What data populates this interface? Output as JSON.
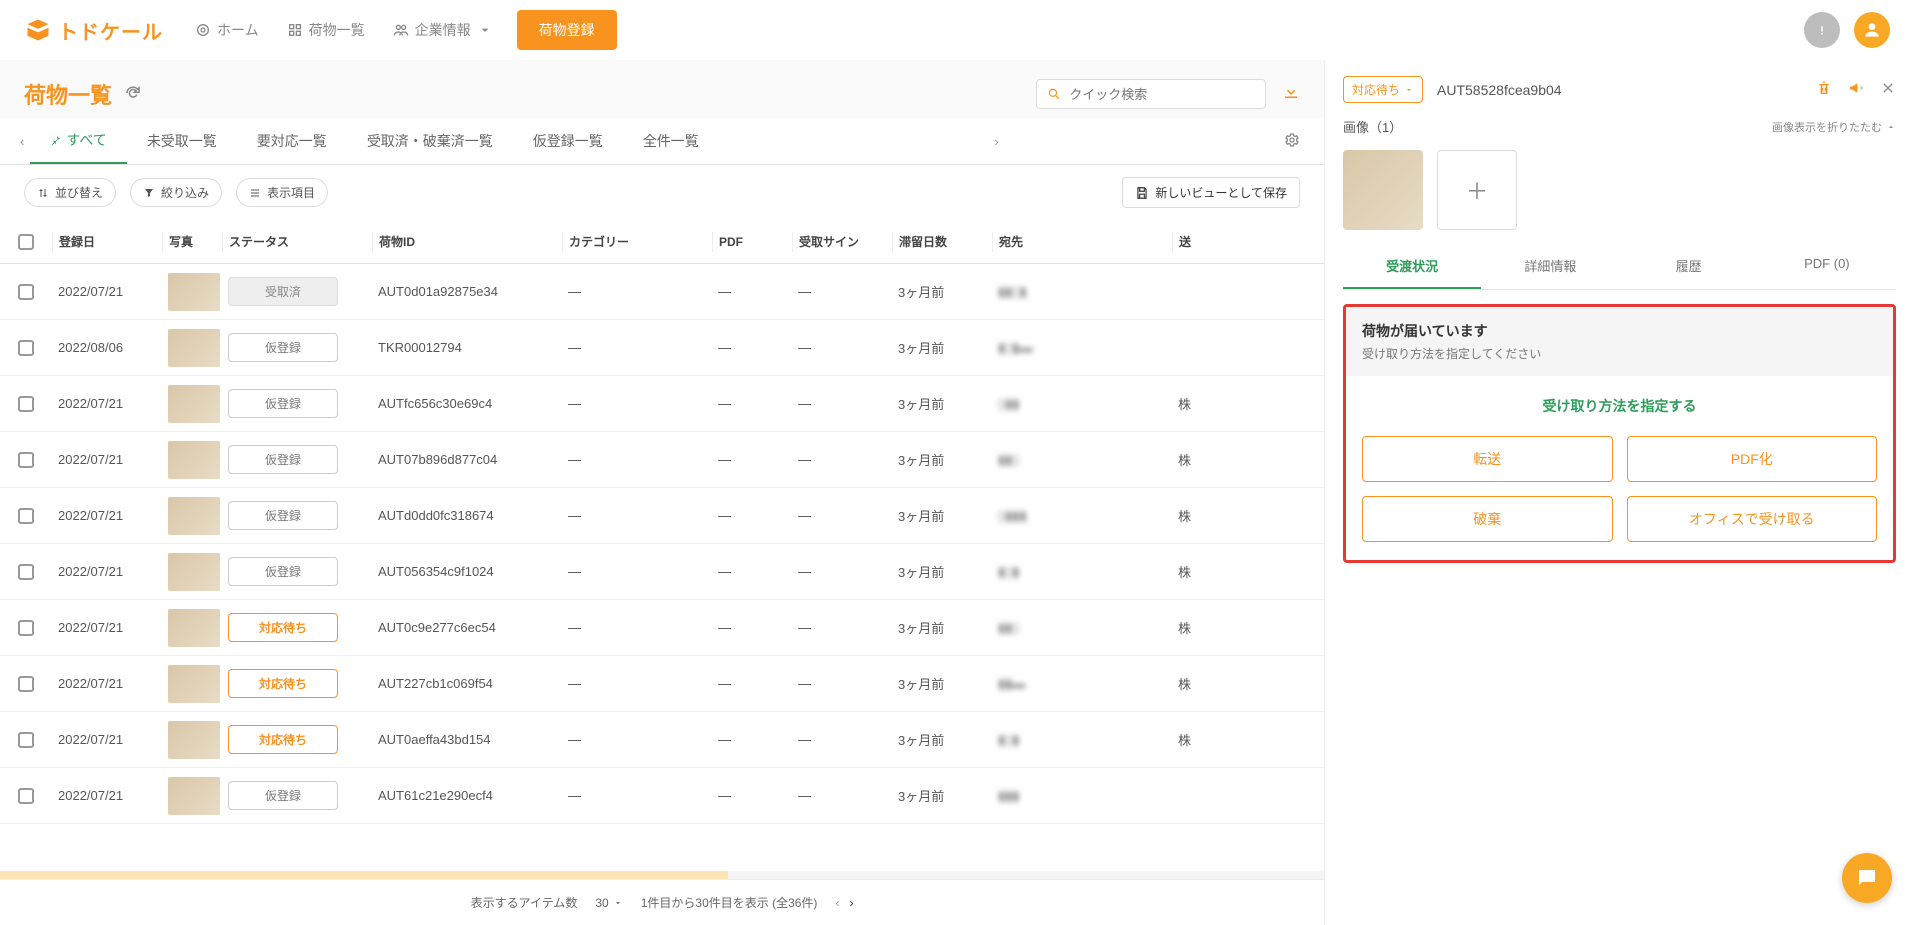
{
  "brand": "トドケール",
  "nav": {
    "home": "ホーム",
    "list": "荷物一覧",
    "company": "企業情報"
  },
  "primary_btn": "荷物登録",
  "page_title": "荷物一覧",
  "search_placeholder": "クイック検索",
  "tabs": {
    "all": "すべて",
    "unreceived": "未受取一覧",
    "needaction": "要対応一覧",
    "done": "受取済・破棄済一覧",
    "draft": "仮登録一覧",
    "everything": "全件一覧"
  },
  "toolbar": {
    "sort": "並び替え",
    "filter": "絞り込み",
    "columns": "表示項目",
    "save_view": "新しいビューとして保存"
  },
  "columns": {
    "date": "登録日",
    "photo": "写真",
    "status": "ステータス",
    "pkgid": "荷物ID",
    "category": "カテゴリー",
    "pdf": "PDF",
    "sign": "受取サイン",
    "days": "滞留日数",
    "dest": "宛先",
    "sender": "送"
  },
  "status_labels": {
    "received": "受取済",
    "draft": "仮登録",
    "pending": "対応待ち"
  },
  "rows": [
    {
      "date": "2022/07/21",
      "status": "received",
      "id": "AUT0d01a92875e34",
      "days": "3ヶ月前",
      "dest": "▮▮▯▮",
      "sender": ""
    },
    {
      "date": "2022/08/06",
      "status": "draft",
      "id": "TKR00012794",
      "days": "3ヶ月前",
      "dest": "▮▯▮▬",
      "sender": ""
    },
    {
      "date": "2022/07/21",
      "status": "draft",
      "id": "AUTfc656c30e69c4",
      "days": "3ヶ月前",
      "dest": "▯▮▮",
      "sender": "株"
    },
    {
      "date": "2022/07/21",
      "status": "draft",
      "id": "AUT07b896d877c04",
      "days": "3ヶ月前",
      "dest": "▮▮▯",
      "sender": "株"
    },
    {
      "date": "2022/07/21",
      "status": "draft",
      "id": "AUTd0dd0fc318674",
      "days": "3ヶ月前",
      "dest": "▯▮▮▮",
      "sender": "株"
    },
    {
      "date": "2022/07/21",
      "status": "draft",
      "id": "AUT056354c9f1024",
      "days": "3ヶ月前",
      "dest": "▮▯▮",
      "sender": "株"
    },
    {
      "date": "2022/07/21",
      "status": "pending",
      "id": "AUT0c9e277c6ec54",
      "days": "3ヶ月前",
      "dest": "▮▮▯",
      "sender": "株"
    },
    {
      "date": "2022/07/21",
      "status": "pending",
      "id": "AUT227cb1c069f54",
      "days": "3ヶ月前",
      "dest": "▮▮▬",
      "sender": "株"
    },
    {
      "date": "2022/07/21",
      "status": "pending",
      "id": "AUT0aeffa43bd154",
      "days": "3ヶ月前",
      "dest": "▮▯▮",
      "sender": "株"
    },
    {
      "date": "2022/07/21",
      "status": "draft",
      "id": "AUT61c21e290ecf4",
      "days": "3ヶ月前",
      "dest": "▮▮▮",
      "sender": ""
    }
  ],
  "dash": "—",
  "pager": {
    "label": "表示するアイテム数",
    "size": "30",
    "info": "1件目から30件目を表示 (全36件)"
  },
  "detail": {
    "status": "対応待ち",
    "id": "AUT58528fcea9b04",
    "images_label": "画像（1）",
    "collapse": "画像表示を折りたたむ",
    "tabs": {
      "status": "受渡状況",
      "info": "詳細情報",
      "history": "履歴",
      "pdf": "PDF (0)"
    },
    "notice_title": "荷物が届いています",
    "notice_sub": "受け取り方法を指定してください",
    "method_title": "受け取り方法を指定する",
    "btn_forward": "転送",
    "btn_pdf": "PDF化",
    "btn_discard": "破棄",
    "btn_office": "オフィスで受け取る"
  }
}
